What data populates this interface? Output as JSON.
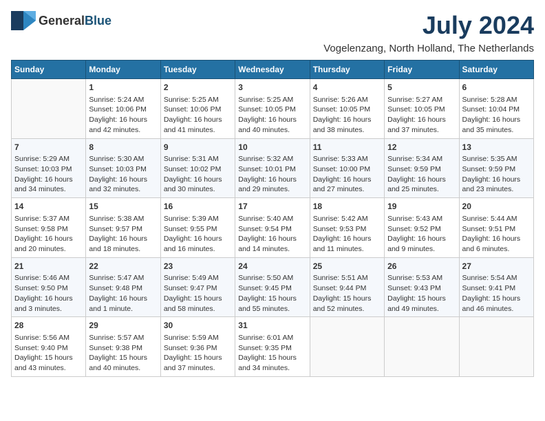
{
  "logo": {
    "general": "General",
    "blue": "Blue"
  },
  "title": "July 2024",
  "location": "Vogelenzang, North Holland, The Netherlands",
  "days_of_week": [
    "Sunday",
    "Monday",
    "Tuesday",
    "Wednesday",
    "Thursday",
    "Friday",
    "Saturday"
  ],
  "weeks": [
    [
      {
        "day": "",
        "info": ""
      },
      {
        "day": "1",
        "info": "Sunrise: 5:24 AM\nSunset: 10:06 PM\nDaylight: 16 hours\nand 42 minutes."
      },
      {
        "day": "2",
        "info": "Sunrise: 5:25 AM\nSunset: 10:06 PM\nDaylight: 16 hours\nand 41 minutes."
      },
      {
        "day": "3",
        "info": "Sunrise: 5:25 AM\nSunset: 10:05 PM\nDaylight: 16 hours\nand 40 minutes."
      },
      {
        "day": "4",
        "info": "Sunrise: 5:26 AM\nSunset: 10:05 PM\nDaylight: 16 hours\nand 38 minutes."
      },
      {
        "day": "5",
        "info": "Sunrise: 5:27 AM\nSunset: 10:05 PM\nDaylight: 16 hours\nand 37 minutes."
      },
      {
        "day": "6",
        "info": "Sunrise: 5:28 AM\nSunset: 10:04 PM\nDaylight: 16 hours\nand 35 minutes."
      }
    ],
    [
      {
        "day": "7",
        "info": "Sunrise: 5:29 AM\nSunset: 10:03 PM\nDaylight: 16 hours\nand 34 minutes."
      },
      {
        "day": "8",
        "info": "Sunrise: 5:30 AM\nSunset: 10:03 PM\nDaylight: 16 hours\nand 32 minutes."
      },
      {
        "day": "9",
        "info": "Sunrise: 5:31 AM\nSunset: 10:02 PM\nDaylight: 16 hours\nand 30 minutes."
      },
      {
        "day": "10",
        "info": "Sunrise: 5:32 AM\nSunset: 10:01 PM\nDaylight: 16 hours\nand 29 minutes."
      },
      {
        "day": "11",
        "info": "Sunrise: 5:33 AM\nSunset: 10:00 PM\nDaylight: 16 hours\nand 27 minutes."
      },
      {
        "day": "12",
        "info": "Sunrise: 5:34 AM\nSunset: 9:59 PM\nDaylight: 16 hours\nand 25 minutes."
      },
      {
        "day": "13",
        "info": "Sunrise: 5:35 AM\nSunset: 9:59 PM\nDaylight: 16 hours\nand 23 minutes."
      }
    ],
    [
      {
        "day": "14",
        "info": "Sunrise: 5:37 AM\nSunset: 9:58 PM\nDaylight: 16 hours\nand 20 minutes."
      },
      {
        "day": "15",
        "info": "Sunrise: 5:38 AM\nSunset: 9:57 PM\nDaylight: 16 hours\nand 18 minutes."
      },
      {
        "day": "16",
        "info": "Sunrise: 5:39 AM\nSunset: 9:55 PM\nDaylight: 16 hours\nand 16 minutes."
      },
      {
        "day": "17",
        "info": "Sunrise: 5:40 AM\nSunset: 9:54 PM\nDaylight: 16 hours\nand 14 minutes."
      },
      {
        "day": "18",
        "info": "Sunrise: 5:42 AM\nSunset: 9:53 PM\nDaylight: 16 hours\nand 11 minutes."
      },
      {
        "day": "19",
        "info": "Sunrise: 5:43 AM\nSunset: 9:52 PM\nDaylight: 16 hours\nand 9 minutes."
      },
      {
        "day": "20",
        "info": "Sunrise: 5:44 AM\nSunset: 9:51 PM\nDaylight: 16 hours\nand 6 minutes."
      }
    ],
    [
      {
        "day": "21",
        "info": "Sunrise: 5:46 AM\nSunset: 9:50 PM\nDaylight: 16 hours\nand 3 minutes."
      },
      {
        "day": "22",
        "info": "Sunrise: 5:47 AM\nSunset: 9:48 PM\nDaylight: 16 hours\nand 1 minute."
      },
      {
        "day": "23",
        "info": "Sunrise: 5:49 AM\nSunset: 9:47 PM\nDaylight: 15 hours\nand 58 minutes."
      },
      {
        "day": "24",
        "info": "Sunrise: 5:50 AM\nSunset: 9:45 PM\nDaylight: 15 hours\nand 55 minutes."
      },
      {
        "day": "25",
        "info": "Sunrise: 5:51 AM\nSunset: 9:44 PM\nDaylight: 15 hours\nand 52 minutes."
      },
      {
        "day": "26",
        "info": "Sunrise: 5:53 AM\nSunset: 9:43 PM\nDaylight: 15 hours\nand 49 minutes."
      },
      {
        "day": "27",
        "info": "Sunrise: 5:54 AM\nSunset: 9:41 PM\nDaylight: 15 hours\nand 46 minutes."
      }
    ],
    [
      {
        "day": "28",
        "info": "Sunrise: 5:56 AM\nSunset: 9:40 PM\nDaylight: 15 hours\nand 43 minutes."
      },
      {
        "day": "29",
        "info": "Sunrise: 5:57 AM\nSunset: 9:38 PM\nDaylight: 15 hours\nand 40 minutes."
      },
      {
        "day": "30",
        "info": "Sunrise: 5:59 AM\nSunset: 9:36 PM\nDaylight: 15 hours\nand 37 minutes."
      },
      {
        "day": "31",
        "info": "Sunrise: 6:01 AM\nSunset: 9:35 PM\nDaylight: 15 hours\nand 34 minutes."
      },
      {
        "day": "",
        "info": ""
      },
      {
        "day": "",
        "info": ""
      },
      {
        "day": "",
        "info": ""
      }
    ]
  ]
}
